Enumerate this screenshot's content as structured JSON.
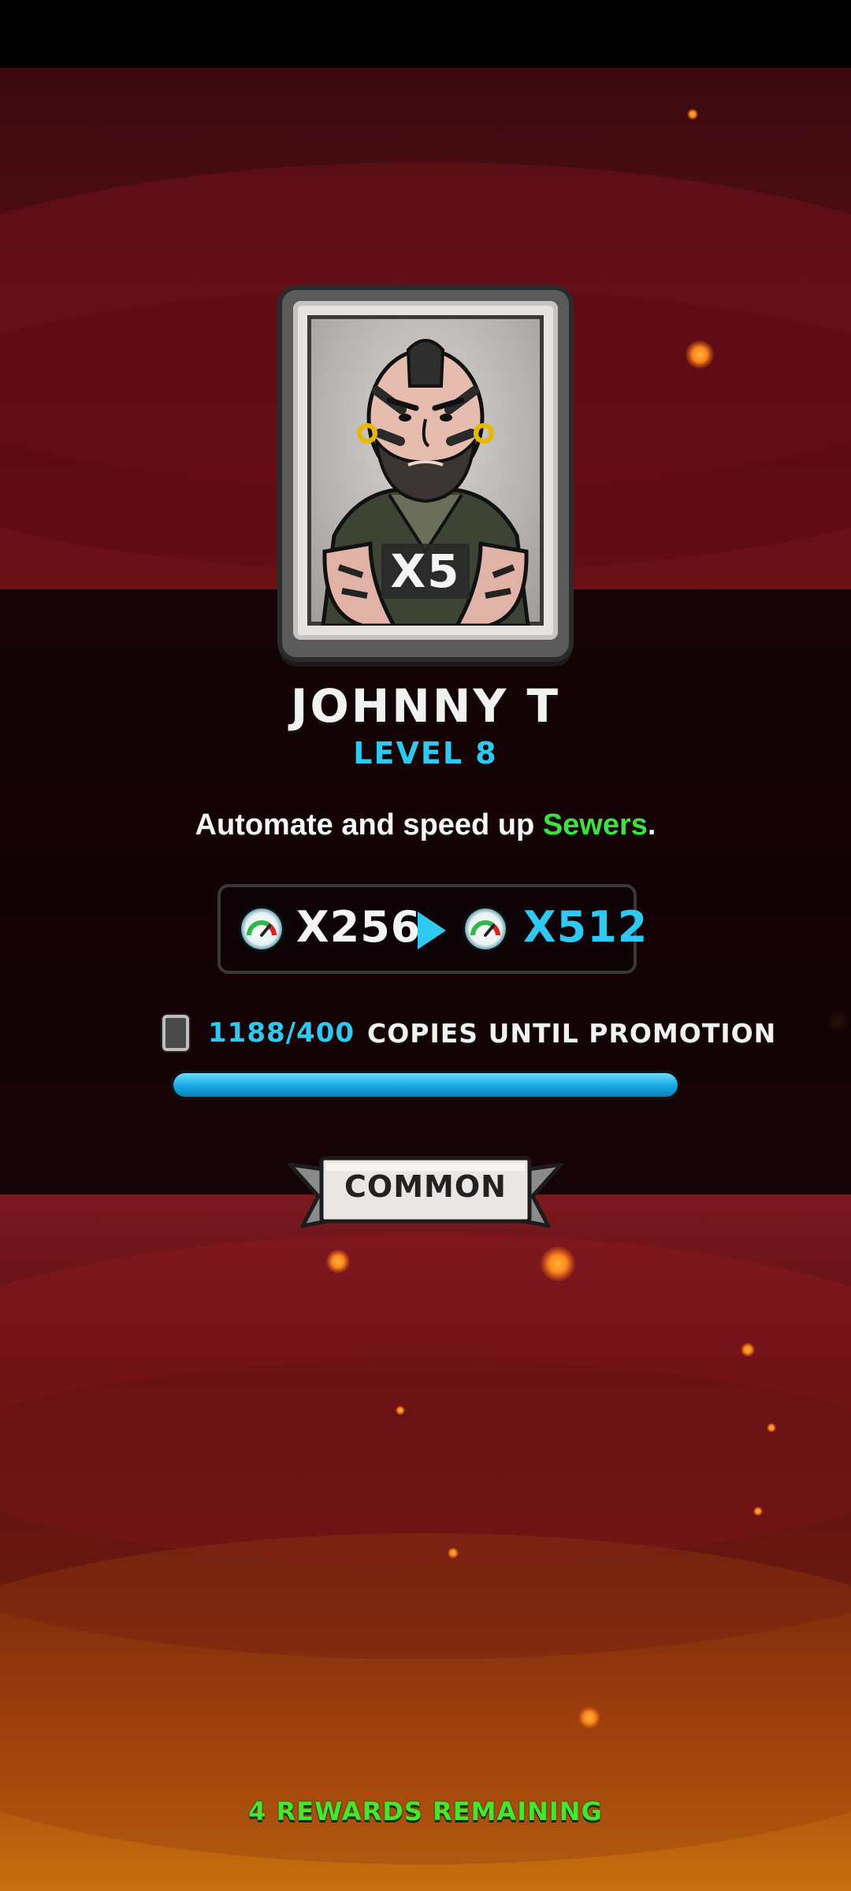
{
  "reward_card": {
    "multiplier": "X5",
    "name": "JOHNNY T",
    "level": "LEVEL 8",
    "portrait_icon": "manager-portrait"
  },
  "description": {
    "prefix": "Automate and speed up ",
    "highlight": "Sewers",
    "suffix": "."
  },
  "boost": {
    "icon": "speed-gauge-icon",
    "from": "X256",
    "to": "X512"
  },
  "copies": {
    "count": "1188/400",
    "label": "COPIES UNTIL PROMOTION",
    "progress_fraction": 1.0
  },
  "rarity": {
    "label": "COMMON"
  },
  "footer": {
    "rewards_remaining": "4 REWARDS REMAINING"
  },
  "colors": {
    "accent_cyan": "#2ec8f0",
    "highlight_green": "#3fe041",
    "rewards_green": "#46e62c"
  }
}
